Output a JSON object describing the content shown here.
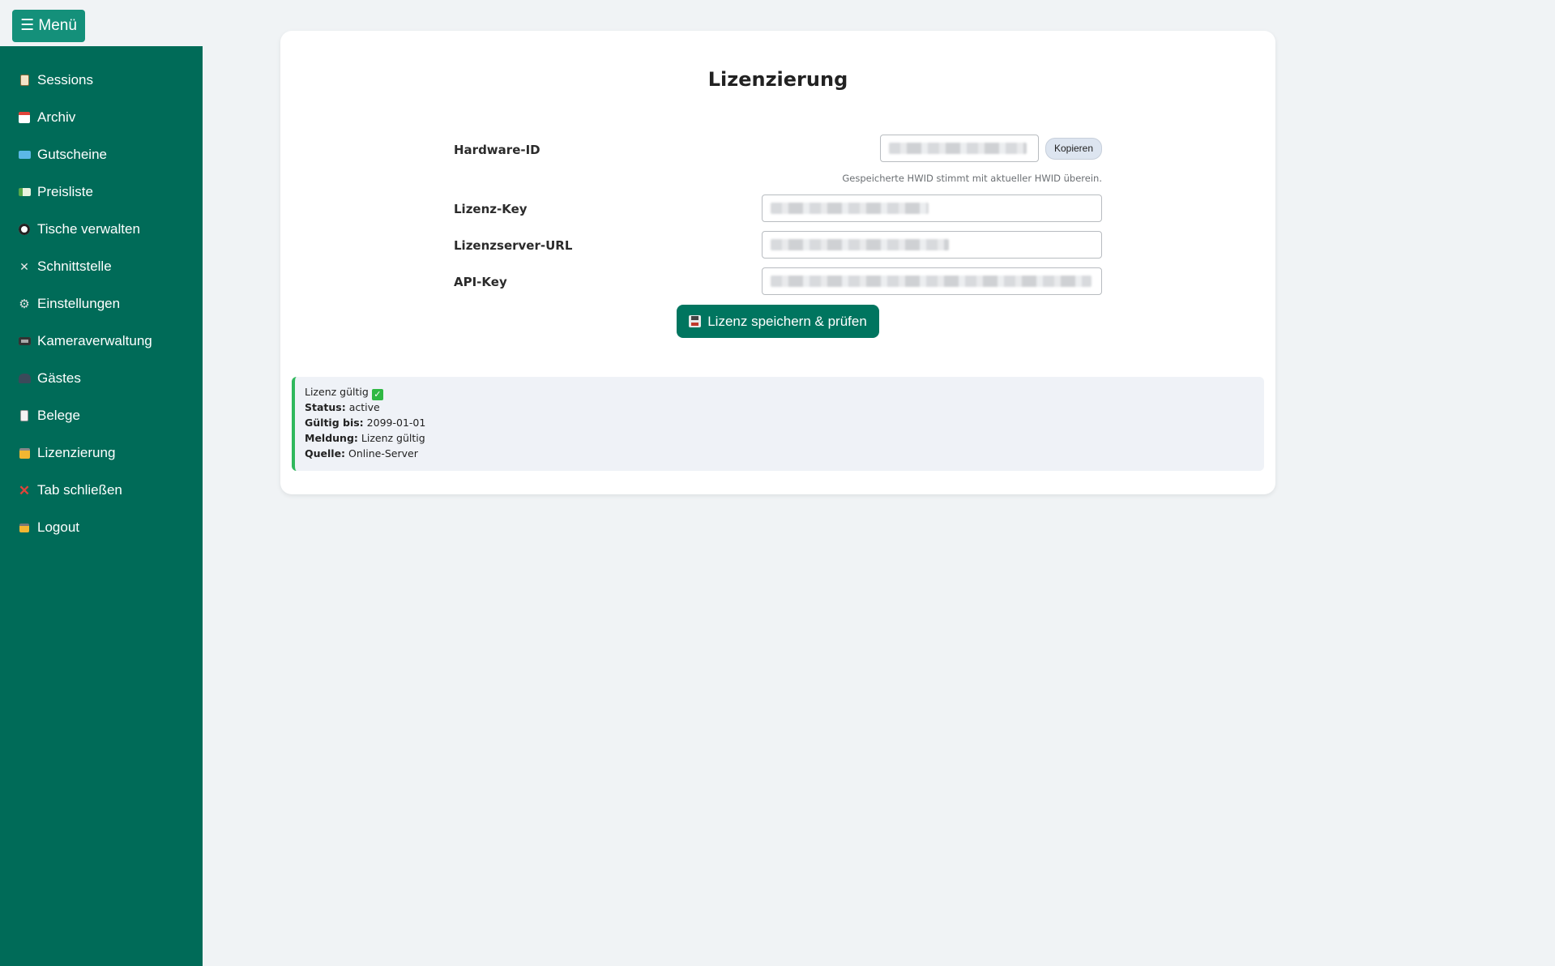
{
  "menu_button": "☰ Menü",
  "sidebar": {
    "items": [
      {
        "label": "Sessions",
        "icon": "clipboard-icon"
      },
      {
        "label": "Archiv",
        "icon": "calendar-icon"
      },
      {
        "label": "Gutscheine",
        "icon": "ticket-icon"
      },
      {
        "label": "Preisliste",
        "icon": "price-card-icon"
      },
      {
        "label": "Tische verwalten",
        "icon": "billiard-ball-icon"
      },
      {
        "label": "Schnittstelle",
        "icon": "tools-icon"
      },
      {
        "label": "Einstellungen",
        "icon": "gear-icon"
      },
      {
        "label": "Kameraverwaltung",
        "icon": "camera-icon"
      },
      {
        "label": "Gästes",
        "icon": "users-icon"
      },
      {
        "label": "Belege",
        "icon": "receipt-icon"
      },
      {
        "label": "Lizenzierung",
        "icon": "lock-with-key-icon"
      },
      {
        "label": "Tab schließen",
        "icon": "cross-mark-icon"
      },
      {
        "label": "Logout",
        "icon": "lock-icon"
      }
    ]
  },
  "license": {
    "title": "Lizenzierung",
    "hardware_id_label": "Hardware-ID",
    "copy_button": "Kopieren",
    "hwid_hint": "Gespeicherte HWID stimmt mit aktueller HWID überein.",
    "license_key_label": "Lizenz-Key",
    "server_url_label": "Lizenzserver-URL",
    "api_key_label": "API-Key",
    "save_button": "Lizenz speichern & prüfen"
  },
  "status": {
    "headline": "Lizenz gültig",
    "status_label": "Status:",
    "status_value": "active",
    "valid_until_label": "Gültig bis:",
    "valid_until_value": "2099-01-01",
    "message_label": "Meldung:",
    "message_value": "Lizenz gültig",
    "source_label": "Quelle:",
    "source_value": "Online-Server"
  },
  "colors": {
    "sidebar": "#006b58",
    "menu_button": "#14907a",
    "primary_button": "#00755f",
    "success_border": "#2fb85c"
  }
}
